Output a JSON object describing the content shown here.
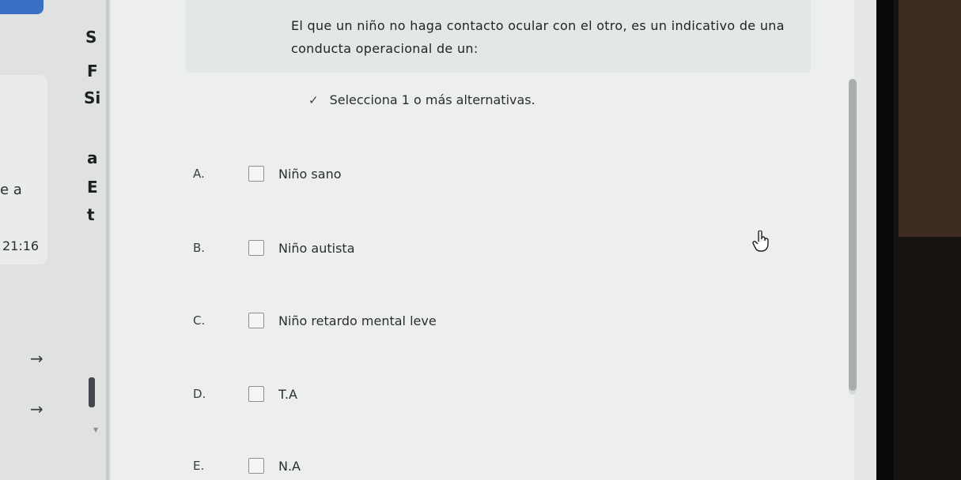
{
  "question": {
    "text": "El que un niño no haga contacto ocular con el otro, es un indicativo de una conducta operacional de un:"
  },
  "instruction": "Selecciona 1 o más alternativas.",
  "options": [
    {
      "letter": "A.",
      "label": "Niño sano"
    },
    {
      "letter": "B.",
      "label": "Niño autista"
    },
    {
      "letter": "C.",
      "label": "Niño retardo mental leve"
    },
    {
      "letter": "D.",
      "label": "T.A"
    },
    {
      "letter": "E.",
      "label": "N.A"
    }
  ],
  "left_panel": {
    "partial_text": "e a",
    "time": "21:16",
    "letters": [
      "S",
      "F",
      "Si",
      "a",
      "E",
      "t"
    ]
  },
  "colors": {
    "top_tab": "#3b6fc4",
    "question_bg": "#e2e8e6",
    "page_bg": "#edefed"
  }
}
